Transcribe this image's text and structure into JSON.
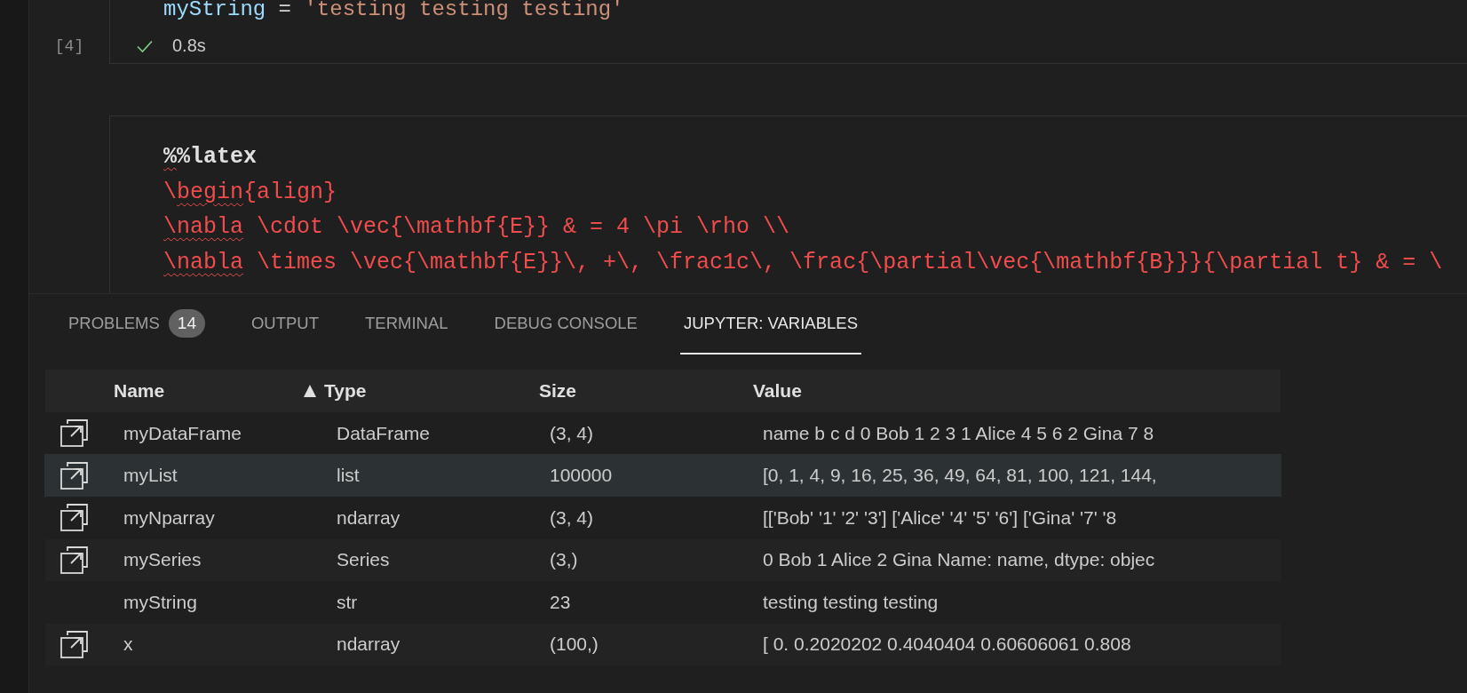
{
  "notebook": {
    "cells": [
      {
        "exec_count": "[4]",
        "code": [
          {
            "tokens": [
              {
                "text": "myString",
                "kind": "variable",
                "error": false
              },
              {
                "text": " = ",
                "kind": "operator",
                "error": false
              },
              {
                "text": "'testing testing testing'",
                "kind": "string",
                "error": false
              }
            ]
          }
        ],
        "status": {
          "success": true,
          "duration": "0.8s"
        }
      },
      {
        "code": [
          {
            "tokens": [
              {
                "text": "%",
                "kind": "magic",
                "error": true
              },
              {
                "text": "%latex",
                "kind": "magic",
                "error": false
              }
            ]
          },
          {
            "tokens": [
              {
                "text": "\\",
                "kind": "latex",
                "error": false
              },
              {
                "text": "begin",
                "kind": "latex",
                "error": true
              },
              {
                "text": "{align}",
                "kind": "latex",
                "error": false
              }
            ]
          },
          {
            "tokens": [
              {
                "text": "\\nabla",
                "kind": "latex",
                "error": true
              },
              {
                "text": " \\cdot \\vec{\\mathbf{E}} & = 4 \\pi \\rho \\\\",
                "kind": "latex",
                "error": false
              }
            ]
          },
          {
            "tokens": [
              {
                "text": "\\nabla",
                "kind": "latex",
                "error": true
              },
              {
                "text": " \\times \\vec{\\mathbf{E}}\\, +\\, \\frac1c\\, \\frac{\\partial\\vec{\\mathbf{B}}}{\\partial t} & = \\",
                "kind": "latex",
                "error": false
              }
            ]
          }
        ]
      }
    ]
  },
  "panel": {
    "tabs": [
      {
        "label": "PROBLEMS",
        "badge": "14",
        "selected": false
      },
      {
        "label": "OUTPUT",
        "selected": false
      },
      {
        "label": "TERMINAL",
        "selected": false
      },
      {
        "label": "DEBUG CONSOLE",
        "selected": false
      },
      {
        "label": "JUPYTER: VARIABLES",
        "selected": true
      }
    ],
    "variables": {
      "columns": [
        {
          "label": "Name",
          "sorted": false
        },
        {
          "label": "Type",
          "sorted": true
        },
        {
          "label": "Size",
          "sorted": false
        },
        {
          "label": "Value",
          "sorted": false
        }
      ],
      "rows": [
        {
          "name": "myDataFrame",
          "type": "DataFrame",
          "size": "(3, 4)",
          "value": "name b c d 0 Bob 1 2 3 1 Alice 4 5 6 2 Gina 7 8",
          "viewer": true,
          "selected": false
        },
        {
          "name": "myList",
          "type": "list",
          "size": "100000",
          "value": "[0, 1, 4, 9, 16, 25, 36, 49, 64, 81, 100, 121, 144,",
          "viewer": true,
          "selected": true
        },
        {
          "name": "myNparray",
          "type": "ndarray",
          "size": "(3, 4)",
          "value": "[['Bob' '1' '2' '3'] ['Alice' '4' '5' '6'] ['Gina' '7' '8",
          "viewer": true,
          "selected": false
        },
        {
          "name": "mySeries",
          "type": "Series",
          "size": "(3,)",
          "value": "0 Bob 1 Alice 2 Gina Name: name, dtype: objec",
          "viewer": true,
          "selected": false
        },
        {
          "name": "myString",
          "type": "str",
          "size": "23",
          "value": "testing testing testing",
          "viewer": false,
          "selected": false
        },
        {
          "name": "x",
          "type": "ndarray",
          "size": "(100,)",
          "value": "[ 0. 0.2020202 0.4040404 0.60606061 0.808",
          "viewer": true,
          "selected": false
        }
      ]
    }
  }
}
